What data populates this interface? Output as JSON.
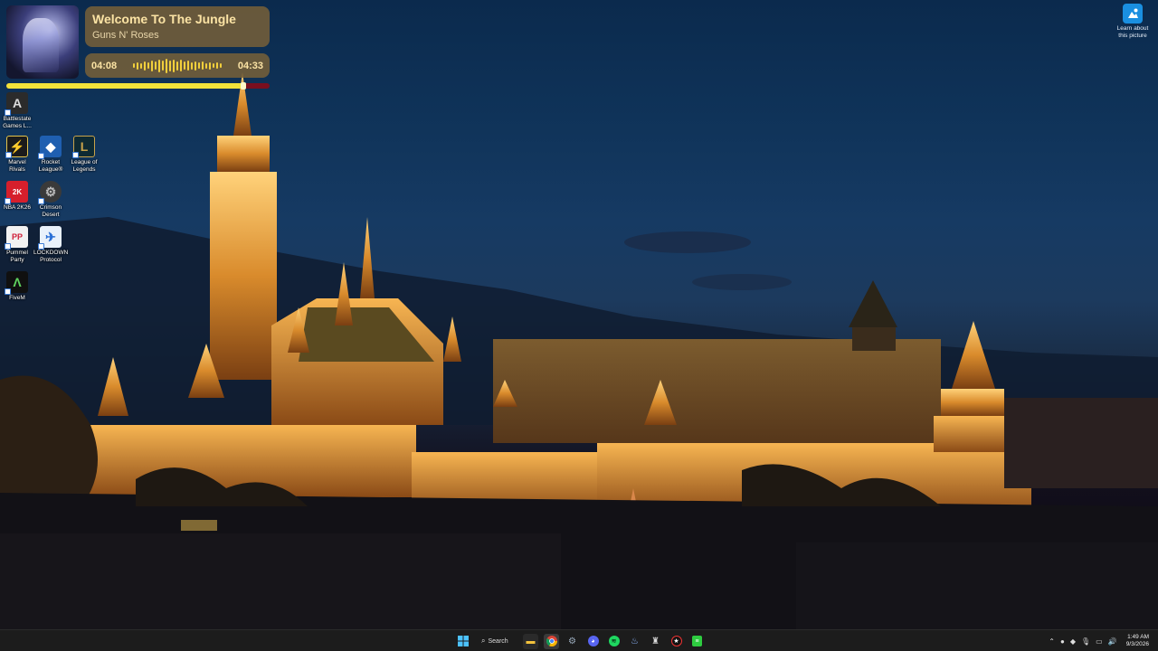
{
  "now_playing": {
    "title": "Welcome To The Jungle",
    "artist": "Guns N' Roses",
    "elapsed": "04:08",
    "duration": "04:33",
    "progress_fraction": 0.9
  },
  "desktop_icons": [
    {
      "label": "Battlestate Games L...",
      "icon": "battlestate-icon"
    },
    {
      "label": "Marvel Rivals",
      "icon": "marvel-rivals-icon"
    },
    {
      "label": "Rocket League®",
      "icon": "rocket-league-icon"
    },
    {
      "label": "League of Legends",
      "icon": "league-of-legends-icon"
    },
    {
      "label": "NBA 2K26",
      "icon": "nba-2k26-icon"
    },
    {
      "label": "Crimson Desert",
      "icon": "crimson-desert-icon"
    },
    {
      "label": "Pummel Party",
      "icon": "pummel-party-icon"
    },
    {
      "label": "LOCKDOWN Protocol",
      "icon": "lockdown-protocol-icon"
    },
    {
      "label": "FiveM",
      "icon": "fivem-icon"
    }
  ],
  "spotlight": {
    "label": "Learn about this picture"
  },
  "taskbar": {
    "search_label": "Search",
    "apps": [
      "start-icon",
      "search-icon",
      "file-explorer-icon",
      "chrome-icon",
      "settings-icon",
      "discord-icon",
      "spotify-icon",
      "steam-icon",
      "task-icon",
      "rockstar-icon",
      "notes-icon"
    ],
    "time": "1:49 AM",
    "date": "9/3/2026"
  },
  "colors": {
    "widget_bg": "#786038",
    "widget_text": "#fbe3a4",
    "wave": "#f2cf3c",
    "progress_fill": "#f2e23a",
    "progress_track": "#7a0f1f",
    "taskbar_bg": "#1c1c1c"
  }
}
